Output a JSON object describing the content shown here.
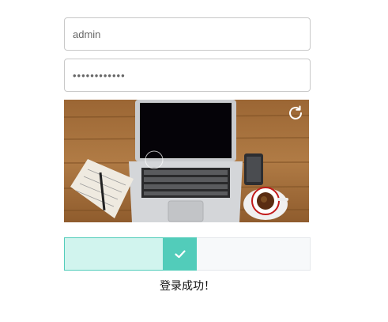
{
  "login": {
    "username_value": "admin",
    "password_value": "••••••••••••"
  },
  "captcha": {
    "image_subject": "desk-laptop-coffee-notebook-photo",
    "refresh_icon": "refresh-icon"
  },
  "slider": {
    "progress_fraction": 0.465,
    "knob_icon": "checkmark-icon",
    "fill_color": "#d1f4ee",
    "accent_color": "#52ccba",
    "track_color": "#f7f9fa"
  },
  "status": {
    "message": "登录成功！"
  }
}
